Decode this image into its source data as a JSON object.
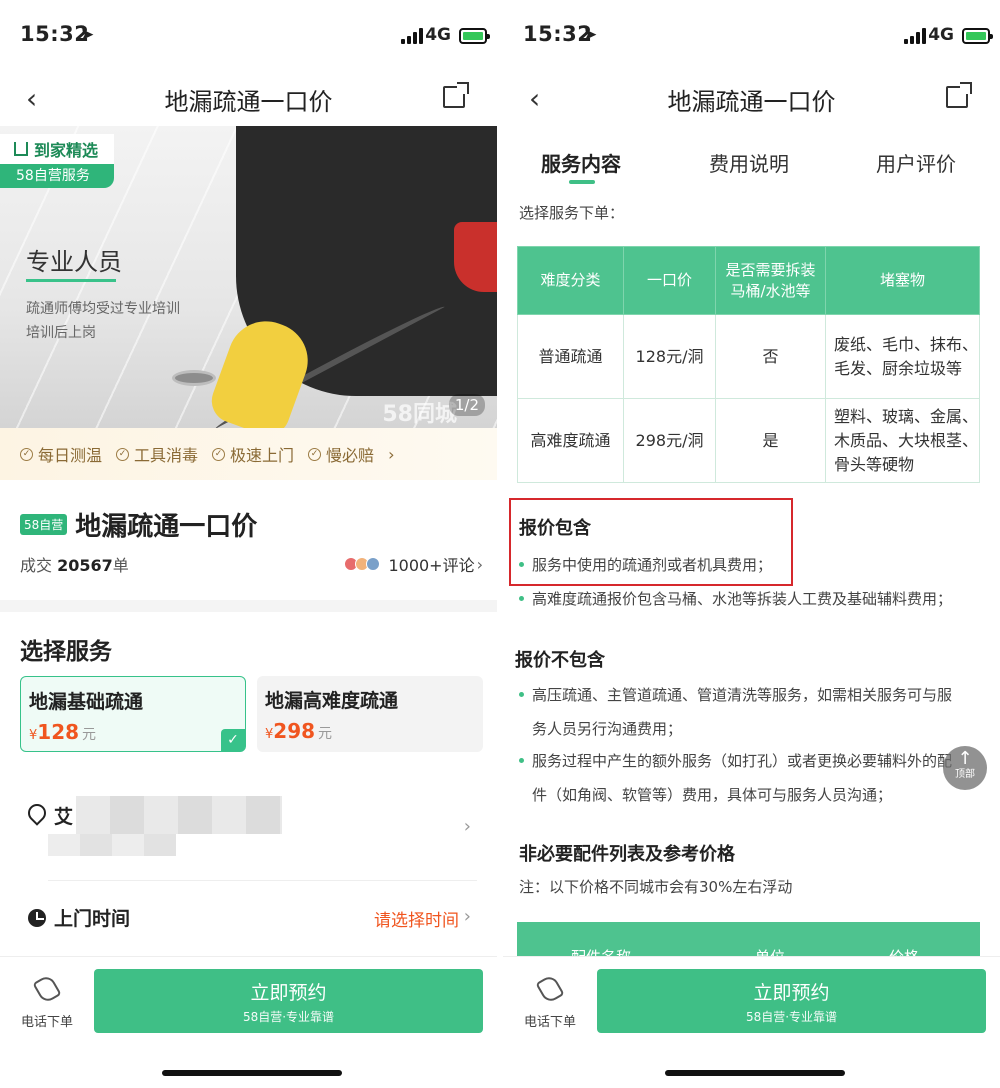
{
  "status": {
    "time": "15:32",
    "network": "4G"
  },
  "nav": {
    "title": "地漏疏通一口价"
  },
  "hero": {
    "brand_top": "到家精选",
    "brand_bottom": "58自营服务",
    "heading": "专业人员",
    "desc_1": "疏通师傅均受过专业培训",
    "desc_2": "培训后上岗",
    "pager": "1/2",
    "watermark": "58同城"
  },
  "guarantees": [
    "每日测温",
    "工具消毒",
    "极速上门",
    "慢必赔"
  ],
  "product": {
    "tag": "58自营",
    "name": "地漏疏通一口价",
    "deal_prefix": "成交",
    "deal_count": "20567",
    "deal_suffix": "单",
    "reviews": "1000+评论"
  },
  "services": {
    "title": "选择服务",
    "options": [
      {
        "name": "地漏基础疏通",
        "currency": "¥",
        "price": "128",
        "unit": "元"
      },
      {
        "name": "地漏高难度疏通",
        "currency": "¥",
        "price": "298",
        "unit": "元"
      }
    ]
  },
  "address": {
    "label": "艾"
  },
  "visit": {
    "label": "上门时间",
    "value": "请选择时间"
  },
  "bottom": {
    "phone_label": "电话下单",
    "book_main": "立即预约",
    "book_sub": "58自营·专业靠谱"
  },
  "tabs": [
    "服务内容",
    "费用说明",
    "用户评价"
  ],
  "detail": {
    "choose": "选择服务下单：",
    "table_headers": [
      "难度分类",
      "一口价",
      "是否需要拆装马桶/水池等",
      "堵塞物"
    ],
    "table_rows": [
      [
        "普通疏通",
        "128元/洞",
        "否",
        "废纸、毛巾、抹布、毛发、厨余垃圾等"
      ],
      [
        "高难度疏通",
        "298元/洞",
        "是",
        "塑料、玻璃、金属、木质品、大块根茎、骨头等硬物"
      ]
    ],
    "include_title": "报价包含",
    "include_items": [
      "服务中使用的疏通剂或者机具费用；",
      "高难度疏通报价包含马桶、水池等拆装人工费及基础辅料费用；"
    ],
    "exclude_title": "报价不包含",
    "exclude_items": [
      {
        "l1": "高压疏通、主管道疏通、管道清洗等服务，如需相关服务可与服",
        "l2": "务人员另行沟通费用；"
      },
      {
        "l1": "服务过程中产生的额外服务（如打孔）或者更换必要辅料外的配",
        "l2": "件（如角阀、软管等）费用，具体可与服务人员沟通；"
      }
    ],
    "parts_title": "非必要配件列表及参考价格",
    "parts_note": "注：以下价格不同城市会有30%左右浮动",
    "parts_headers": [
      "配件名称",
      "单位",
      "价格"
    ],
    "top_button": "顶部"
  }
}
